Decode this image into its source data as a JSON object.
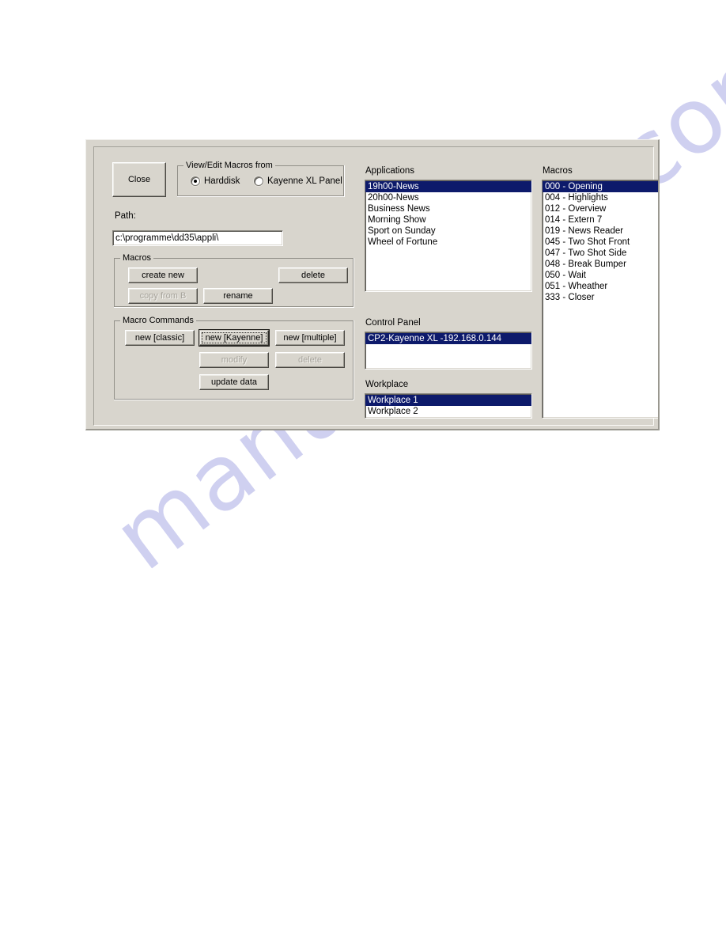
{
  "page": {
    "watermark_text": "manualshive.com",
    "watermark_color": "#c9caee",
    "background_color": "#ffffff"
  },
  "dialog": {
    "background_color": "#d8d5cd",
    "selection_color": "#0d1a6b",
    "close_button": "Close",
    "source_group": {
      "title": "View/Edit Macros from",
      "options": [
        {
          "label": "Harddisk",
          "checked": true
        },
        {
          "label": "Kayenne XL Panel",
          "checked": false
        }
      ]
    },
    "path": {
      "label": "Path:",
      "value": "c:\\programme\\dd35\\appli\\",
      "placeholder": ""
    },
    "macros_group": {
      "title": "Macros",
      "buttons": [
        {
          "label": "create  new",
          "disabled": false
        },
        {
          "label": "delete",
          "disabled": false
        },
        {
          "label": "copy from B",
          "disabled": true
        },
        {
          "label": "rename",
          "disabled": false
        }
      ]
    },
    "macro_commands_group": {
      "title": "Macro Commands",
      "buttons": [
        {
          "label": "new [classic]",
          "disabled": false,
          "focused": false
        },
        {
          "label": "new [Kayenne]",
          "disabled": false,
          "focused": true
        },
        {
          "label": "new [multiple]",
          "disabled": false,
          "focused": false
        },
        {
          "label": "modify",
          "disabled": true,
          "focused": false
        },
        {
          "label": "delete",
          "disabled": true,
          "focused": false
        },
        {
          "label": "update data",
          "disabled": false,
          "focused": false
        }
      ]
    },
    "applications": {
      "label": "Applications",
      "items": [
        {
          "label": "19h00-News",
          "selected": true
        },
        {
          "label": "20h00-News",
          "selected": false
        },
        {
          "label": "Business News",
          "selected": false
        },
        {
          "label": "Morning Show",
          "selected": false
        },
        {
          "label": "Sport on Sunday",
          "selected": false
        },
        {
          "label": "Wheel of Fortune",
          "selected": false
        }
      ]
    },
    "control_panel": {
      "label": "Control Panel",
      "items": [
        {
          "label": "CP2-Kayenne XL -192.168.0.144",
          "selected": true
        }
      ]
    },
    "workplace": {
      "label": "Workplace",
      "items": [
        {
          "label": "Workplace 1",
          "selected": true
        },
        {
          "label": "Workplace 2",
          "selected": false
        }
      ]
    },
    "macros_list": {
      "label": "Macros",
      "items": [
        {
          "label": "000 - Opening",
          "selected": true
        },
        {
          "label": "004 - Highlights",
          "selected": false
        },
        {
          "label": "012 - Overview",
          "selected": false
        },
        {
          "label": "014 - Extern 7",
          "selected": false
        },
        {
          "label": "019 - News Reader",
          "selected": false
        },
        {
          "label": "045 - Two Shot Front",
          "selected": false
        },
        {
          "label": "047 - Two Shot Side",
          "selected": false
        },
        {
          "label": "048 - Break Bumper",
          "selected": false
        },
        {
          "label": "050 - Wait",
          "selected": false
        },
        {
          "label": "051 - Wheather",
          "selected": false
        },
        {
          "label": "333 -  Closer",
          "selected": false
        }
      ]
    }
  }
}
